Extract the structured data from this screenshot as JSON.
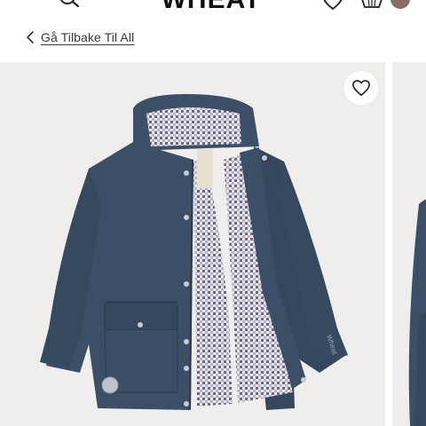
{
  "header": {
    "logo_text": "WHEAT",
    "menu_icon": "menu-icon",
    "search_icon": "search-icon",
    "wishlist_icon": "heart-icon",
    "basket_icon": "basket-icon"
  },
  "back_link": {
    "label": "Gå Tilbake Til All",
    "icon": "chevron-left-icon"
  },
  "gallery": {
    "favorite_icon": "heart-icon",
    "product_brand_print": "Wheat"
  },
  "colors": {
    "jacket": "#3b4f66",
    "badge": "#8a6e64",
    "image_bg": "#efeeec"
  }
}
